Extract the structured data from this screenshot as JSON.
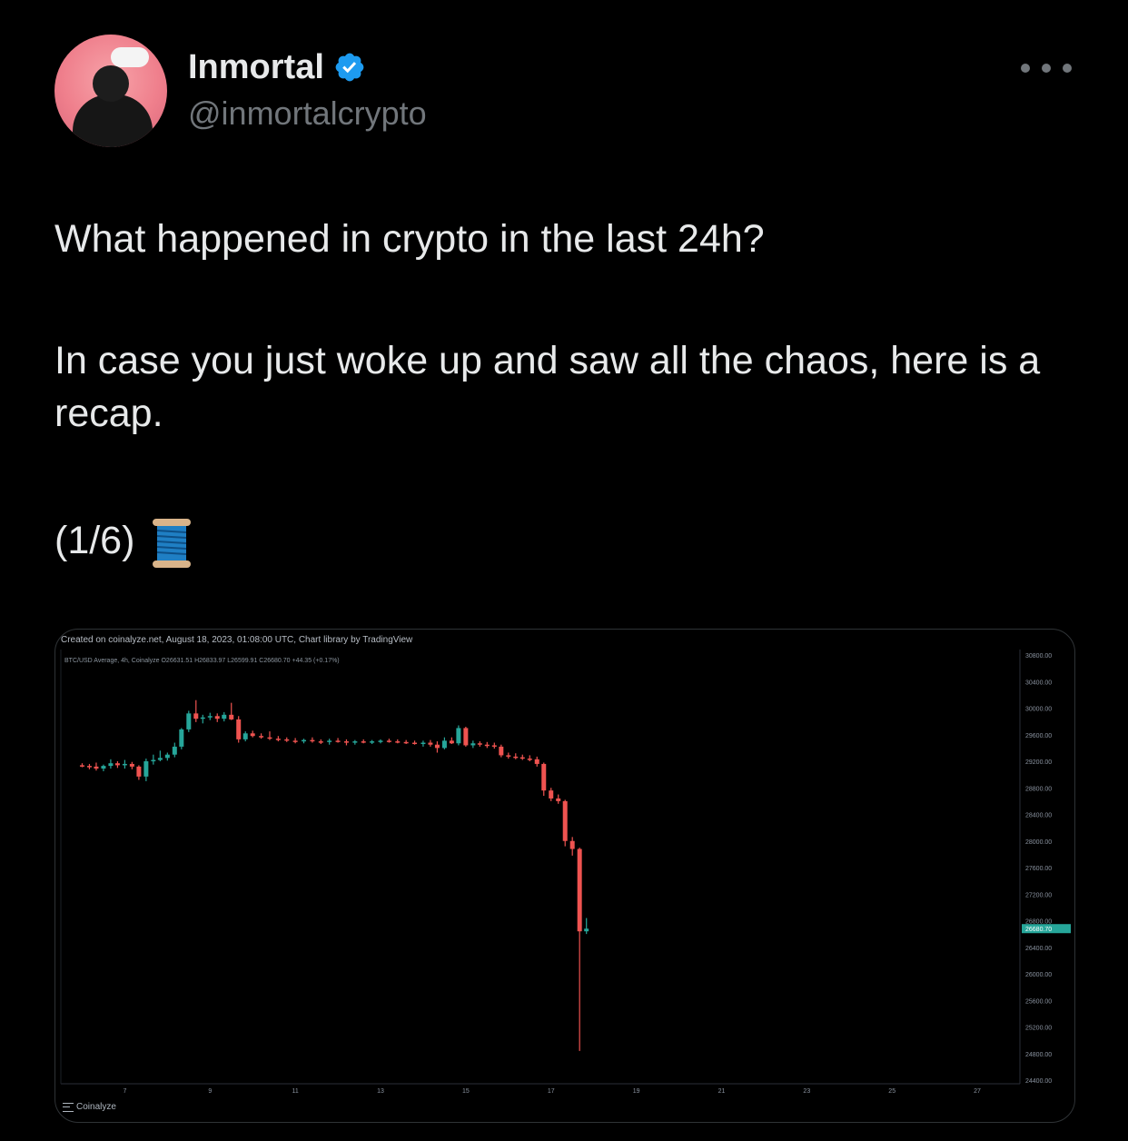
{
  "post": {
    "author_name": "Inmortal",
    "handle": "@inmortalcrypto",
    "text_line1": "What happened in crypto in the last 24h?",
    "text_line2": "In case you just woke up and saw all the chaos, here is a recap.",
    "text_line3": "(1/6)",
    "thread_emoji": "spool-of-thread",
    "verified": true,
    "accent_color": "#1d9bf0"
  },
  "media": {
    "created_text": "Created on coinalyze.net, August 18, 2023, 01:08:00 UTC, Chart library by TradingView",
    "ohlc_text": "BTC/USD Average, 4h, Coinalyze O26631.51 H26833.97 L26599.91 C26680.70 +44.35 (+0.17%)",
    "watermark": "Coinalyze"
  },
  "chart_data": {
    "type": "candlestick",
    "title": "BTC/USD Average, 4h",
    "x_ticks": [
      "7",
      "9",
      "11",
      "13",
      "15",
      "17",
      "19",
      "21",
      "23",
      "25",
      "27"
    ],
    "y_ticks": [
      "30800.00",
      "30400.00",
      "30000.00",
      "29600.00",
      "29200.00",
      "28800.00",
      "28400.00",
      "28000.00",
      "27600.00",
      "27200.00",
      "26800.00",
      "26400.00",
      "26000.00",
      "25600.00",
      "25200.00",
      "24800.00",
      "24400.00"
    ],
    "ylim": [
      24400,
      30800
    ],
    "last_price_label": "26680.70",
    "up_color": "#26a69a",
    "down_color": "#ef5350",
    "grid": false,
    "candles": [
      {
        "day": 6.0,
        "o": 29140,
        "h": 29170,
        "l": 29110,
        "c": 29130
      },
      {
        "day": 6.17,
        "o": 29130,
        "h": 29160,
        "l": 29080,
        "c": 29120
      },
      {
        "day": 6.33,
        "o": 29120,
        "h": 29180,
        "l": 29060,
        "c": 29090
      },
      {
        "day": 6.5,
        "o": 29090,
        "h": 29150,
        "l": 29050,
        "c": 29130
      },
      {
        "day": 6.67,
        "o": 29130,
        "h": 29230,
        "l": 29090,
        "c": 29170
      },
      {
        "day": 6.83,
        "o": 29170,
        "h": 29200,
        "l": 29100,
        "c": 29140
      },
      {
        "day": 7.0,
        "o": 29140,
        "h": 29220,
        "l": 29090,
        "c": 29160
      },
      {
        "day": 7.17,
        "o": 29160,
        "h": 29190,
        "l": 29080,
        "c": 29120
      },
      {
        "day": 7.33,
        "o": 29120,
        "h": 29140,
        "l": 28920,
        "c": 28970
      },
      {
        "day": 7.5,
        "o": 28970,
        "h": 29240,
        "l": 28900,
        "c": 29200
      },
      {
        "day": 7.67,
        "o": 29200,
        "h": 29300,
        "l": 29150,
        "c": 29220
      },
      {
        "day": 7.83,
        "o": 29220,
        "h": 29360,
        "l": 29200,
        "c": 29250
      },
      {
        "day": 8.0,
        "o": 29250,
        "h": 29330,
        "l": 29210,
        "c": 29300
      },
      {
        "day": 8.17,
        "o": 29300,
        "h": 29480,
        "l": 29260,
        "c": 29420
      },
      {
        "day": 8.33,
        "o": 29420,
        "h": 29700,
        "l": 29380,
        "c": 29680
      },
      {
        "day": 8.5,
        "o": 29680,
        "h": 29960,
        "l": 29640,
        "c": 29920
      },
      {
        "day": 8.67,
        "o": 29920,
        "h": 30120,
        "l": 29790,
        "c": 29840
      },
      {
        "day": 8.83,
        "o": 29840,
        "h": 29900,
        "l": 29770,
        "c": 29860
      },
      {
        "day": 9.0,
        "o": 29860,
        "h": 29930,
        "l": 29820,
        "c": 29880
      },
      {
        "day": 9.17,
        "o": 29880,
        "h": 29920,
        "l": 29790,
        "c": 29840
      },
      {
        "day": 9.33,
        "o": 29840,
        "h": 29940,
        "l": 29800,
        "c": 29900
      },
      {
        "day": 9.5,
        "o": 29900,
        "h": 30080,
        "l": 29820,
        "c": 29830
      },
      {
        "day": 9.67,
        "o": 29830,
        "h": 29880,
        "l": 29480,
        "c": 29530
      },
      {
        "day": 9.83,
        "o": 29530,
        "h": 29650,
        "l": 29500,
        "c": 29620
      },
      {
        "day": 10.0,
        "o": 29620,
        "h": 29660,
        "l": 29560,
        "c": 29580
      },
      {
        "day": 10.2,
        "o": 29580,
        "h": 29620,
        "l": 29540,
        "c": 29560
      },
      {
        "day": 10.4,
        "o": 29560,
        "h": 29650,
        "l": 29520,
        "c": 29540
      },
      {
        "day": 10.6,
        "o": 29540,
        "h": 29580,
        "l": 29500,
        "c": 29530
      },
      {
        "day": 10.8,
        "o": 29530,
        "h": 29560,
        "l": 29490,
        "c": 29510
      },
      {
        "day": 11.0,
        "o": 29510,
        "h": 29550,
        "l": 29470,
        "c": 29500
      },
      {
        "day": 11.2,
        "o": 29500,
        "h": 29540,
        "l": 29470,
        "c": 29520
      },
      {
        "day": 11.4,
        "o": 29520,
        "h": 29560,
        "l": 29480,
        "c": 29500
      },
      {
        "day": 11.6,
        "o": 29500,
        "h": 29530,
        "l": 29460,
        "c": 29490
      },
      {
        "day": 11.8,
        "o": 29490,
        "h": 29540,
        "l": 29450,
        "c": 29510
      },
      {
        "day": 12.0,
        "o": 29510,
        "h": 29550,
        "l": 29480,
        "c": 29500
      },
      {
        "day": 12.2,
        "o": 29500,
        "h": 29530,
        "l": 29440,
        "c": 29480
      },
      {
        "day": 12.4,
        "o": 29480,
        "h": 29520,
        "l": 29450,
        "c": 29500
      },
      {
        "day": 12.6,
        "o": 29500,
        "h": 29530,
        "l": 29470,
        "c": 29490
      },
      {
        "day": 12.8,
        "o": 29490,
        "h": 29520,
        "l": 29460,
        "c": 29500
      },
      {
        "day": 13.0,
        "o": 29500,
        "h": 29530,
        "l": 29470,
        "c": 29510
      },
      {
        "day": 13.2,
        "o": 29510,
        "h": 29540,
        "l": 29480,
        "c": 29500
      },
      {
        "day": 13.4,
        "o": 29500,
        "h": 29530,
        "l": 29470,
        "c": 29490
      },
      {
        "day": 13.6,
        "o": 29490,
        "h": 29520,
        "l": 29460,
        "c": 29480
      },
      {
        "day": 13.8,
        "o": 29480,
        "h": 29510,
        "l": 29450,
        "c": 29470
      },
      {
        "day": 14.0,
        "o": 29470,
        "h": 29510,
        "l": 29420,
        "c": 29480
      },
      {
        "day": 14.17,
        "o": 29480,
        "h": 29520,
        "l": 29420,
        "c": 29450
      },
      {
        "day": 14.33,
        "o": 29450,
        "h": 29500,
        "l": 29330,
        "c": 29400
      },
      {
        "day": 14.5,
        "o": 29400,
        "h": 29560,
        "l": 29380,
        "c": 29510
      },
      {
        "day": 14.67,
        "o": 29510,
        "h": 29560,
        "l": 29460,
        "c": 29470
      },
      {
        "day": 14.83,
        "o": 29470,
        "h": 29740,
        "l": 29440,
        "c": 29700
      },
      {
        "day": 15.0,
        "o": 29700,
        "h": 29720,
        "l": 29420,
        "c": 29440
      },
      {
        "day": 15.17,
        "o": 29440,
        "h": 29510,
        "l": 29400,
        "c": 29470
      },
      {
        "day": 15.33,
        "o": 29470,
        "h": 29500,
        "l": 29420,
        "c": 29450
      },
      {
        "day": 15.5,
        "o": 29450,
        "h": 29490,
        "l": 29400,
        "c": 29440
      },
      {
        "day": 15.67,
        "o": 29440,
        "h": 29480,
        "l": 29390,
        "c": 29420
      },
      {
        "day": 15.83,
        "o": 29420,
        "h": 29450,
        "l": 29260,
        "c": 29290
      },
      {
        "day": 16.0,
        "o": 29290,
        "h": 29330,
        "l": 29240,
        "c": 29270
      },
      {
        "day": 16.17,
        "o": 29270,
        "h": 29320,
        "l": 29230,
        "c": 29260
      },
      {
        "day": 16.33,
        "o": 29260,
        "h": 29300,
        "l": 29220,
        "c": 29240
      },
      {
        "day": 16.5,
        "o": 29240,
        "h": 29290,
        "l": 29200,
        "c": 29230
      },
      {
        "day": 16.67,
        "o": 29230,
        "h": 29270,
        "l": 29120,
        "c": 29160
      },
      {
        "day": 16.83,
        "o": 29160,
        "h": 29180,
        "l": 28680,
        "c": 28760
      },
      {
        "day": 17.0,
        "o": 28760,
        "h": 28800,
        "l": 28600,
        "c": 28640
      },
      {
        "day": 17.17,
        "o": 28640,
        "h": 28700,
        "l": 28560,
        "c": 28600
      },
      {
        "day": 17.33,
        "o": 28600,
        "h": 28620,
        "l": 27920,
        "c": 28000
      },
      {
        "day": 17.5,
        "o": 28000,
        "h": 28060,
        "l": 27780,
        "c": 27880
      },
      {
        "day": 17.67,
        "o": 27880,
        "h": 27900,
        "l": 24840,
        "c": 26640
      },
      {
        "day": 17.83,
        "o": 26640,
        "h": 26840,
        "l": 26600,
        "c": 26680
      }
    ]
  }
}
